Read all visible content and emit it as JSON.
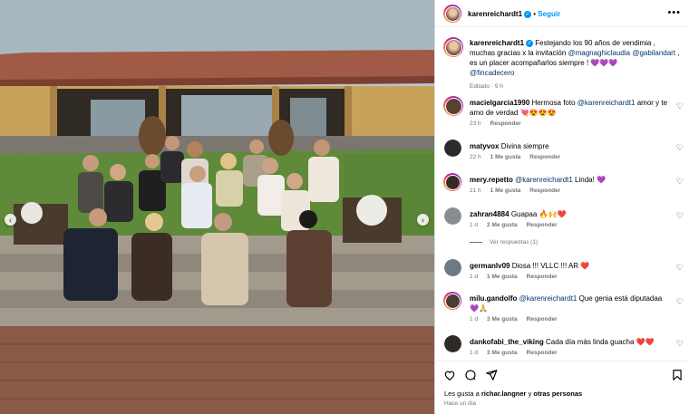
{
  "post": {
    "username": "karenreichardt1",
    "follow_label": "Seguir",
    "caption_pre": "Festejando los 90 años de vendimia , muchas gracias x la invitación ",
    "caption_mention1": "@magnaghiclaudia",
    "caption_mid": " ",
    "caption_mention2": "@gabilandart",
    "caption_post": " , es un placer acompañarlos siempre ! 💜💜💜",
    "caption_mention3": "@fincadecero",
    "caption_meta": "Editado · 9 h"
  },
  "comments": [
    {
      "username": "macielgarcia1990",
      "text_pre": "Hermosa foto ",
      "mention": "@karenreichardt1",
      "text_post": " amor y te amo de verdad 💘😍😍😍",
      "time": "23 h",
      "likes": "",
      "reply": "Responder"
    },
    {
      "username": "matyvox",
      "text_pre": "Divina siempre",
      "mention": "",
      "text_post": "",
      "time": "22 h",
      "likes": "1 Me gusta",
      "reply": "Responder"
    },
    {
      "username": "mery.repetto",
      "text_pre": "",
      "mention": "@karenreichardt1",
      "text_post": " Linda! 💜",
      "time": "21 h",
      "likes": "1 Me gusta",
      "reply": "Responder"
    },
    {
      "username": "zahran4884",
      "text_pre": "Guapaa 🔥🙌❤️",
      "mention": "",
      "text_post": "",
      "time": "1 d",
      "likes": "2 Me gusta",
      "reply": "Responder",
      "replies": "Ver respuestas (1)"
    },
    {
      "username": "germanlv09",
      "text_pre": "Diosa !!! VLLC !!! AR ❤️",
      "mention": "",
      "text_post": "",
      "time": "1 d",
      "likes": "1 Me gusta",
      "reply": "Responder"
    },
    {
      "username": "milu.gandolfo",
      "text_pre": "",
      "mention": "@karenreichardt1",
      "text_post": " Que genia está diputadaa 💜🙏",
      "time": "1 d",
      "likes": "3 Me gusta",
      "reply": "Responder"
    },
    {
      "username": "dankofabi_the_viking",
      "text_pre": "Cada día más linda guacha ❤️❤️",
      "mention": "",
      "text_post": "",
      "time": "1 d",
      "likes": "3 Me gusta",
      "reply": "Responder"
    }
  ],
  "footer": {
    "likes_pre": "Les gusta a ",
    "likes_user": "richar.langner",
    "likes_mid": " y ",
    "likes_others": "otras personas",
    "ago": "Hace un día"
  },
  "icons": {
    "like": "heart-outline-icon",
    "comment": "comment-icon",
    "share": "send-icon",
    "save": "bookmark-icon",
    "more": "more-options-icon",
    "prev": "chevron-left-icon",
    "next": "chevron-right-icon"
  },
  "colors": {
    "link_blue": "#0095f6",
    "mention": "#00376b",
    "muted": "#737373"
  }
}
